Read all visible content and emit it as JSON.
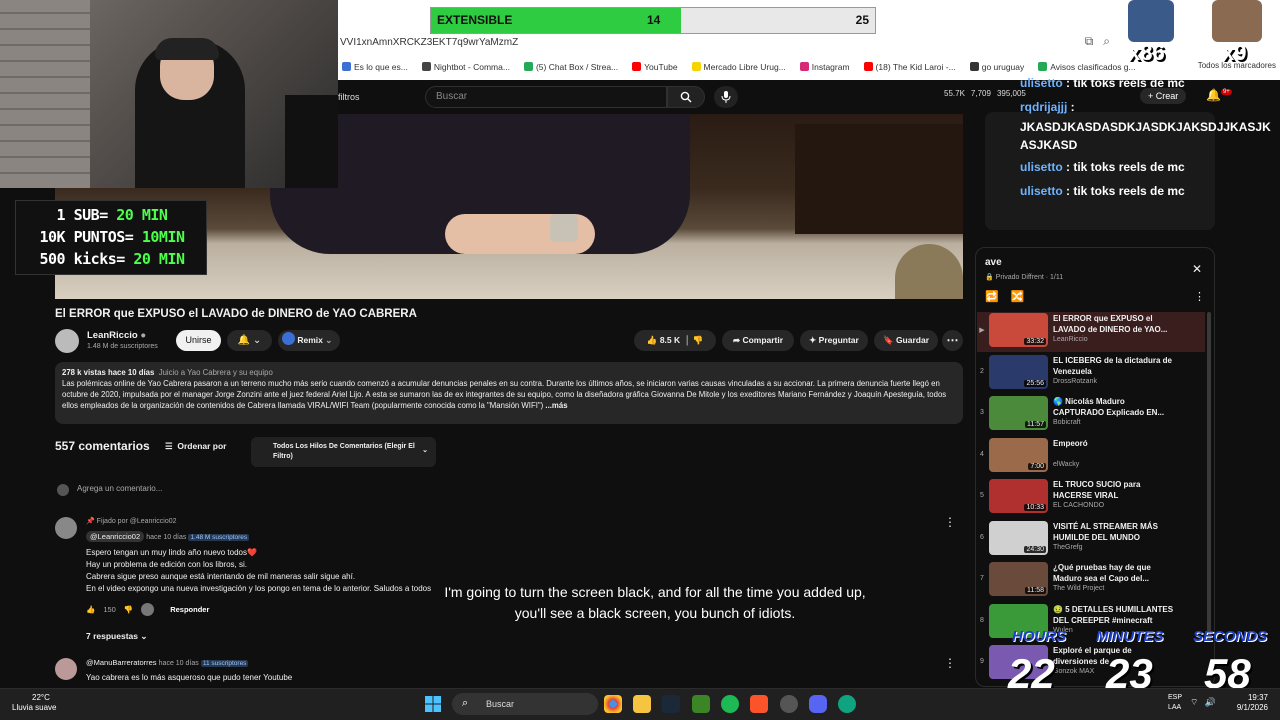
{
  "browser": {
    "url": "VVI1xnAmnXRCKZ3EKT7q9wrYaMzmZ",
    "bookmarks": [
      {
        "label": "Es lo que es...",
        "color": "#3b6fd6"
      },
      {
        "label": "Nightbot - Comma...",
        "color": "#444444"
      },
      {
        "label": "(5) Chat Box / Strea...",
        "color": "#22aa55"
      },
      {
        "label": "YouTube",
        "color": "#ff0000"
      },
      {
        "label": "Mercado Libre Urug...",
        "color": "#f5d400"
      },
      {
        "label": "Instagram",
        "color": "#d62976"
      },
      {
        "label": "(18) The Kid Laroi -...",
        "color": "#ff0000"
      },
      {
        "label": "go uruguay",
        "color": "#333333"
      },
      {
        "label": "Avisos clasificados g...",
        "color": "#22aa55"
      }
    ],
    "all_bookmarks": "Todos los marcadores"
  },
  "youtube": {
    "filters_label": "filtros",
    "search_placeholder": "Buscar",
    "stats": {
      "a": "55.7K",
      "b": "7,709",
      "c": "395,005"
    },
    "create_label": "+ Crear",
    "notif_badge": "9+",
    "video_title": "El ERROR que EXPUSO el LAVADO de DINERO de YAO CABRERA",
    "channel": {
      "name": "LeanRiccio",
      "subs": "1.48 M de suscriptores"
    },
    "buttons": {
      "join": "Unirse",
      "remix": "Remix",
      "likes": "8.5 K",
      "share": "Compartir",
      "ask": "Preguntar",
      "save": "Guardar"
    },
    "description": {
      "meta": "278 k vistas  hace 10 días",
      "tags": "Juicio a Yao Cabrera y su equipo",
      "body": "Las polémicas online de Yao Cabrera pasaron a un terreno mucho más serio cuando comenzó a acumular denuncias penales en su contra. Durante los últimos años, se iniciaron varias causas vinculadas a su accionar. La primera denuncia fuerte llegó en octubre de 2020, impulsada por el manager Jorge Zonzini ante el juez federal Ariel Lijo. A esta se sumaron las de ex integrantes de su equipo, como la diseñadora gráfica Giovanna De Mitole y los exeditores Mariano Fernández y Joaquín Apesteguía, todos ellos empleados de la organización de contenidos de Cabrera llamada VIRAL/WIFI Team (popularmente conocida como la \"Mansión WIFI\")",
      "more": "...más"
    },
    "comments": {
      "count": "557 comentarios",
      "sort_label": "Ordenar por",
      "filter_label": "Todos Los Hilos De Comentarios (Elegir El Filtro)",
      "add_placeholder": "Agrega un comentario...",
      "pinned_by": "Fijado por @Leanriccio02",
      "first": {
        "author": "@Leanriccio02",
        "time": "hace 10 días",
        "badge": "1.48 M suscriptores",
        "lines": [
          "Espero tengan un muy lindo año nuevo todos❤️",
          "Hay un problema de edición con los libros, si.",
          "Cabrera sigue preso aunque está intentando de mil maneras salir sigue ahí.",
          "En el video expongo una nueva investigación y los pongo en tema de lo anterior. Saludos a todos"
        ],
        "likes": "150",
        "reply_label": "Responder",
        "replies": "7 respuestas"
      },
      "second": {
        "author": "@ManuBarreratorres",
        "time": "hace 10 días",
        "badge": "11 suscriptores",
        "text": "Yao cabrera es lo más asqueroso que pudo tener Youtube"
      }
    },
    "playlist": {
      "title": "ave",
      "meta": "Privado  Diffrent  ·  1/11",
      "items": [
        {
          "num": "▶",
          "title": "El ERROR que EXPUSO el LAVADO de DINERO de YAO...",
          "channel": "LeanRiccio",
          "duration": "33:32",
          "color": "#c94a3a"
        },
        {
          "num": "2",
          "title": "EL ICEBERG de la dictadura de Venezuela",
          "channel": "DrossRotzank",
          "duration": "25:56",
          "color": "#2a3a6a"
        },
        {
          "num": "3",
          "title": "🌎 Nicolás Maduro CAPTURADO Explicado EN...",
          "channel": "Bobicraft",
          "duration": "11:57",
          "color": "#4a8a3a"
        },
        {
          "num": "4",
          "title": "Empeoró",
          "channel": "elWacky",
          "duration": "7:00",
          "color": "#9a6a4a"
        },
        {
          "num": "5",
          "title": "EL TRUCO SUCIO para HACERSE VIRAL",
          "channel": "EL CACHONDO",
          "duration": "10:33",
          "color": "#b03030"
        },
        {
          "num": "6",
          "title": "VISITÉ AL STREAMER MÁS HUMILDE DEL MUNDO",
          "channel": "TheGrefg",
          "duration": "24:30",
          "color": "#d0d0d0"
        },
        {
          "num": "7",
          "title": "¿Qué pruebas hay de que Maduro sea el Capo del...",
          "channel": "The Wild Project",
          "duration": "11:58",
          "color": "#6a4a3a"
        },
        {
          "num": "8",
          "title": "🤢 5 DETALLES HUMILLANTES DEL CREEPER #minecraft",
          "channel": "Wulen",
          "duration": "",
          "color": "#3a9a3a"
        },
        {
          "num": "9",
          "title": "Exploré el parque de diversiones de ...",
          "channel": "Gonzok MAX",
          "duration": "",
          "color": "#7a5ab0"
        }
      ]
    }
  },
  "stream_overlay": {
    "lines": [
      {
        "pre": "1 SUB= ",
        "val": "20 MIN"
      },
      {
        "pre": "10K PUNTOS= ",
        "val": "10MIN"
      },
      {
        "pre": "500 kicks= ",
        "val": "20 MIN"
      }
    ],
    "goal": {
      "label": "EXTENSIBLE",
      "current": "14",
      "max": "25",
      "fraction": 0.56
    },
    "multipliers": {
      "a": "x86",
      "b": "x9"
    },
    "chat": [
      {
        "user": "ulisetto",
        "msg": "tik toks reels de mc"
      },
      {
        "user": "rqdrijajjj",
        "msg": "JKASDJKASDASDKJASDKJAKSDJJKASJKASJKASD"
      },
      {
        "user": "ulisetto",
        "msg": "tik toks reels de mc"
      },
      {
        "user": "ulisetto",
        "msg": "tik toks reels de mc"
      }
    ],
    "subtitle": "I'm going to turn the screen black, and for all the time you added up, you'll see a black screen, you bunch of idiots.",
    "timer": {
      "hours_label": "HOURS",
      "minutes_label": "MINUTES",
      "seconds_label": "SECONDS",
      "hours": "22",
      "minutes": "23",
      "seconds": "58"
    }
  },
  "taskbar": {
    "weather_temp": "22°C",
    "weather_desc": "Lluvia suave",
    "search_label": "Buscar",
    "lang": "ESP",
    "lang2": "LAA",
    "time": "19:37",
    "date": "9/1/2026"
  }
}
